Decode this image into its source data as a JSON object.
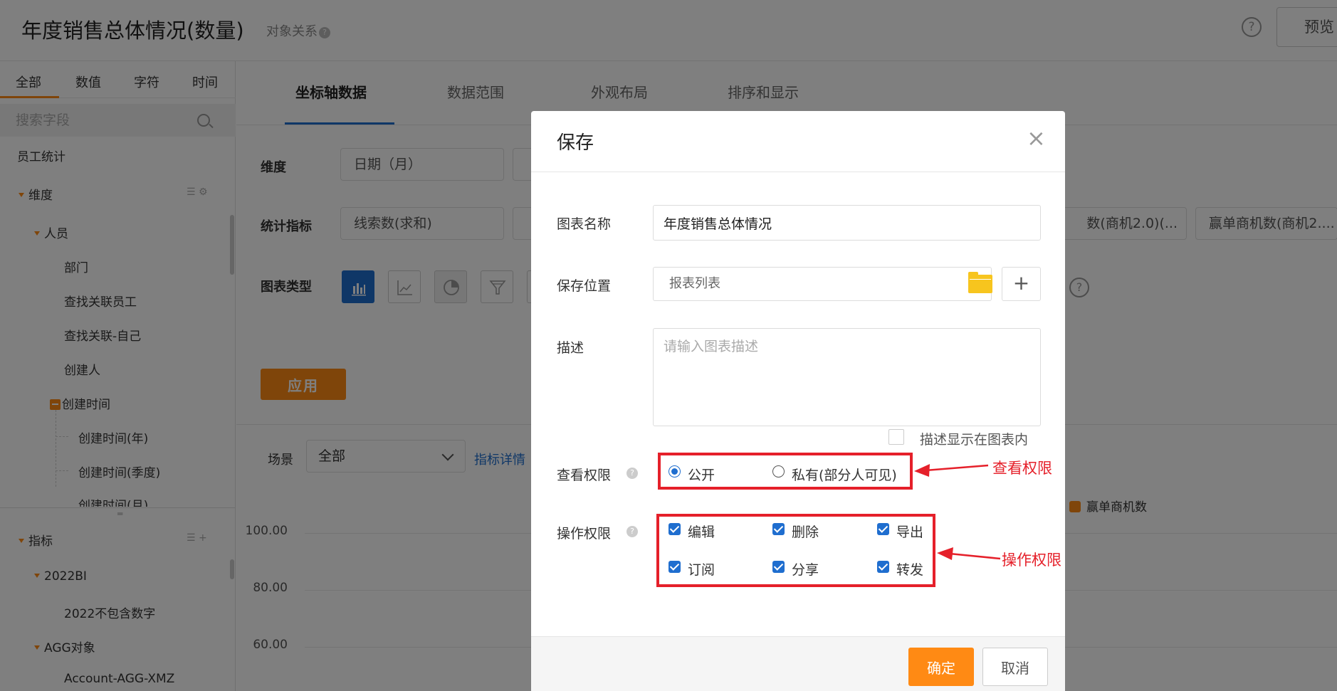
{
  "header": {
    "title": "年度销售总体情况(数量)",
    "object_relation": "对象关系",
    "help_glyph": "?",
    "preview_label": "预览"
  },
  "sidebar": {
    "tabs": [
      {
        "label": "全部",
        "active": true
      },
      {
        "label": "数值"
      },
      {
        "label": "字符"
      },
      {
        "label": "时间"
      }
    ],
    "search_placeholder": "搜索字段",
    "root_label": "员工统计",
    "dimension_label": "维度",
    "person_label": "人员",
    "person_items": [
      "部门",
      "查找关联员工",
      "查找关联-自己",
      "创建人"
    ],
    "create_time_label": "创建时间",
    "create_time_items": [
      "创建时间(年)",
      "创建时间(季度)",
      "创建时间(月)"
    ],
    "metrics_label": "指标",
    "bi_label": "2022BI",
    "bi_items": [
      "2022不包含数字"
    ],
    "agg_label": "AGG对象",
    "agg_items": [
      "Account-AGG-XMZ"
    ]
  },
  "main": {
    "tabs": [
      {
        "label": "坐标轴数据",
        "active": true
      },
      {
        "label": "数据范围"
      },
      {
        "label": "外观布局"
      },
      {
        "label": "排序和显示"
      }
    ],
    "dimension_label": "维度",
    "dimension_chip": "日期（月）",
    "metric_label": "统计指标",
    "metric_chips": [
      "线索数(求和)",
      "数(商机2.0)(...",
      "赢单商机数(商机2...."
    ],
    "chart_type_label": "图表类型",
    "apply_label": "应用",
    "scene_label": "场景",
    "scene_value": "全部",
    "indicator_link": "指标详情",
    "legend_label": "赢单商机数",
    "y_ticks": [
      "100.00",
      "80.00",
      "60.00"
    ],
    "help_glyph": "?"
  },
  "modal": {
    "title": "保存",
    "close_glyph": "×",
    "chart_name_label": "图表名称",
    "chart_name_value": "年度销售总体情况",
    "location_label": "保存位置",
    "location_value": "报表列表",
    "plus_glyph": "+",
    "desc_label": "描述",
    "desc_placeholder": "请输入图表描述",
    "desc_show_label": "描述显示在图表内",
    "view_perm_label": "查看权限",
    "view_options": [
      {
        "label": "公开",
        "checked": true
      },
      {
        "label": "私有(部分人可见)",
        "checked": false
      }
    ],
    "op_perm_label": "操作权限",
    "op_options": [
      {
        "label": "编辑",
        "checked": true
      },
      {
        "label": "删除",
        "checked": true
      },
      {
        "label": "导出",
        "checked": true
      },
      {
        "label": "订阅",
        "checked": true
      },
      {
        "label": "分享",
        "checked": true
      },
      {
        "label": "转发",
        "checked": true
      }
    ],
    "q_glyph": "?",
    "ok_label": "确定",
    "cancel_label": "取消"
  },
  "callouts": {
    "view_perm": "查看权限",
    "op_perm": "操作权限",
    "color": "#e5202a"
  },
  "colors": {
    "accent": "#ff8a14",
    "primary": "#1f6ecf"
  }
}
